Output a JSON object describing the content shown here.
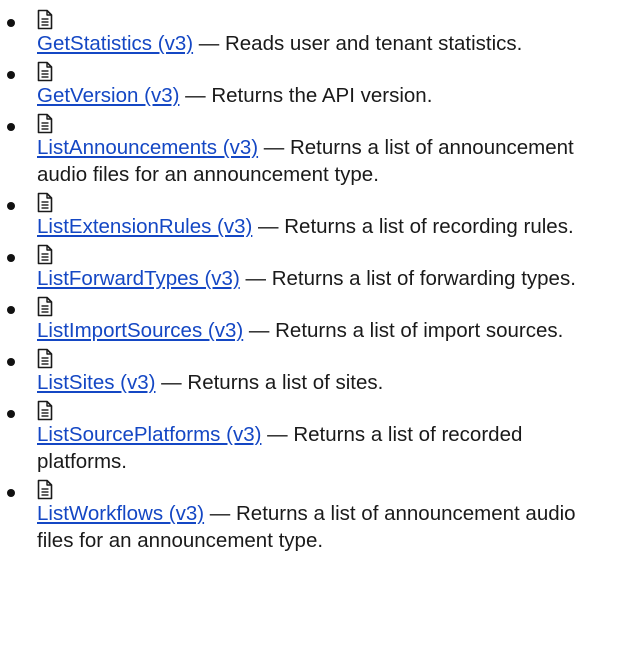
{
  "items": [
    {
      "icon": "document-icon",
      "link": "GetStatistics (v3)",
      "separator": " — ",
      "description": "Reads user and tenant statistics."
    },
    {
      "icon": "document-icon",
      "link": "GetVersion (v3)",
      "separator": " — ",
      "description": "Returns the API version."
    },
    {
      "icon": "document-icon",
      "link": "ListAnnouncements (v3)",
      "separator": " — ",
      "description": "Returns a list of announcement audio files for an announcement type."
    },
    {
      "icon": "document-icon",
      "link": "ListExtensionRules (v3)",
      "separator": " — ",
      "description": "Returns a list of recording rules."
    },
    {
      "icon": "document-icon",
      "link": "ListForwardTypes (v3)",
      "separator": " — ",
      "description": "Returns a list of forwarding types."
    },
    {
      "icon": "document-icon",
      "link": "ListImportSources (v3)",
      "separator": " — ",
      "description": "Returns a list of import sources."
    },
    {
      "icon": "document-icon",
      "link": "ListSites (v3)",
      "separator": " — ",
      "description": "Returns a list of sites."
    },
    {
      "icon": "document-icon",
      "link": "ListSourcePlatforms (v3)",
      "separator": " — ",
      "description": "Returns a list of recorded platforms."
    },
    {
      "icon": "document-icon",
      "link": "ListWorkflows (v3)",
      "separator": " — ",
      "description": "Returns a list of announcement audio files for an announcement type."
    }
  ],
  "colors": {
    "link": "#1447c4",
    "text": "#1a1a1a",
    "bullet": "#111111"
  }
}
